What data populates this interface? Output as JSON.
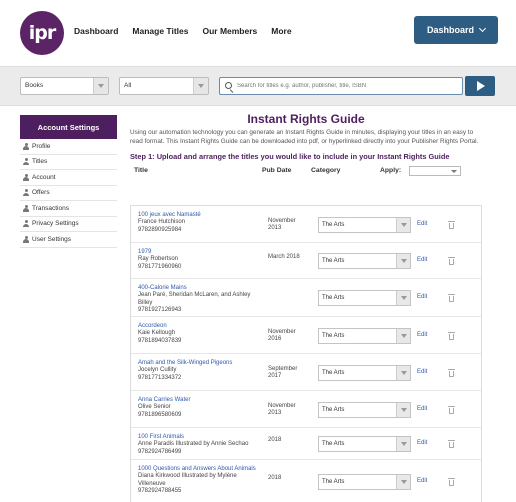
{
  "logo": {
    "text": "ipr"
  },
  "nav": [
    {
      "id": "dashboard",
      "label": "Dashboard"
    },
    {
      "id": "manage-titles",
      "label": "Manage Titles"
    },
    {
      "id": "our-members",
      "label": "Our Members"
    },
    {
      "id": "more",
      "label": "More"
    }
  ],
  "dashboard_button": {
    "label": "Dashboard"
  },
  "search": {
    "type_select": "Books",
    "scope_select": "All",
    "placeholder": "Search for titles e.g. author, publisher, title, ISBN"
  },
  "sidebar": {
    "heading": "Account Settings",
    "items": [
      {
        "label": "Profile"
      },
      {
        "label": "Titles"
      },
      {
        "label": "Account"
      },
      {
        "label": "Offers"
      },
      {
        "label": "Transactions"
      },
      {
        "label": "Privacy Settings"
      },
      {
        "label": "User Settings"
      }
    ]
  },
  "main": {
    "title": "Instant Rights Guide",
    "intro": "Using our automation technology you can generate an Instant Rights Guide in minutes, displaying your titles in an easy to read format. This Instant Rights Guide can be downloaded into pdf, or hyperlinked directly into your Publisher Rights Portal.",
    "step": "Step 1: Upload and arrange the titles you would like to include in your Instant Rights Guide",
    "columns": {
      "title": "Title",
      "pub_date": "Pub Date",
      "category": "Category",
      "apply": "Apply:"
    },
    "edit_label": "Edit",
    "rows": [
      {
        "title": "100 jeux avec Namasté",
        "author": "France Hutchison",
        "isbn": "9782890925984",
        "pub_date": "November 2013",
        "category": "The Arts"
      },
      {
        "title": "1979",
        "author": "Ray Robertson",
        "isbn": "9781771960960",
        "pub_date": "March 2018",
        "category": "The Arts"
      },
      {
        "title": "400-Calorie Mains",
        "author": "Jean Paré, Sheridan McLaren, and Ashley Billey",
        "isbn": "9781927126943",
        "pub_date": "",
        "category": "The Arts"
      },
      {
        "title": "Accordeon",
        "author": "Kaie Kellough",
        "isbn": "9781894037839",
        "pub_date": "November 2016",
        "category": "The Arts"
      },
      {
        "title": "Amah and the Silk-Winged Pigeons",
        "author": "Jocelyn Cullity",
        "isbn": "9781771334372",
        "pub_date": "September 2017",
        "category": "The Arts"
      },
      {
        "title": "Anna Carries Water",
        "author": "Olive Senior",
        "isbn": "9781896580609",
        "pub_date": "November 2013",
        "category": "The Arts"
      },
      {
        "title": "100 First Animals",
        "author": "Anne Paradis Illustrated by Annie Sechao",
        "isbn": "9782924786499",
        "pub_date": "2018",
        "category": "The Arts"
      },
      {
        "title": "1000 Questions and Answers About Animals",
        "author": "Diana Kirkwood Illustrated by Mylène Villeneuve",
        "isbn": "9782924788455",
        "pub_date": "2018",
        "category": "The Arts"
      }
    ]
  },
  "colors": {
    "brand_purple": "#4d1f5e",
    "brand_blue": "#2e5d84",
    "link_blue": "#2e5aa8"
  }
}
